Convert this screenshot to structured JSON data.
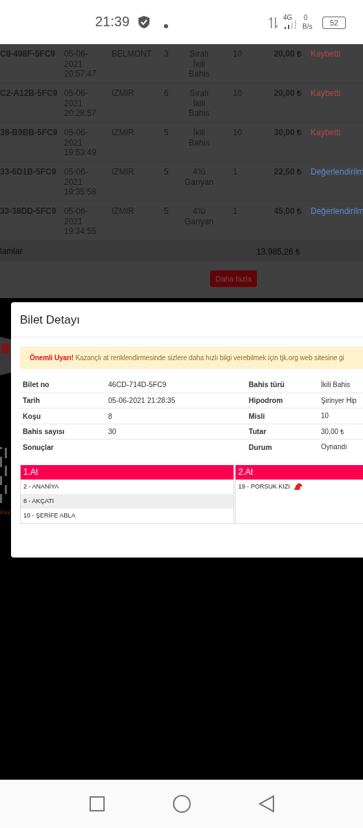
{
  "status_bar": {
    "time": "21:39",
    "network": "4G",
    "speed_value": "0",
    "speed_unit": "B/s",
    "battery": "52"
  },
  "background_table": {
    "rows": [
      {
        "ticket": "C8-498F-5FC9",
        "date": "05-06-2021 20:57:47",
        "hippodrome": "BELMONT",
        "race": "3",
        "bet_type": "Sıralı İkili Bahis",
        "multiplier": "10",
        "amount": "20,00 ₺",
        "status": "Kaybetti",
        "kind": "lost"
      },
      {
        "ticket": "C2-A12B-5FC9",
        "date": "05-06-2021 20:28:57",
        "hippodrome": "IZMIR",
        "race": "6",
        "bet_type": "Sıralı İkili Bahis",
        "multiplier": "10",
        "amount": "20,00 ₺",
        "status": "Kaybetti",
        "kind": "lost"
      },
      {
        "ticket": "38-B9BB-5FC9",
        "date": "05-06-2021 19:53:49",
        "hippodrome": "IZMIR",
        "race": "5",
        "bet_type": "İkili Bahis",
        "multiplier": "10",
        "amount": "30,00 ₺",
        "status": "Kaybetti",
        "kind": "lost"
      },
      {
        "ticket": "33-6D1B-5FC9",
        "date": "05-06-2021 19:35:58",
        "hippodrome": "IZMIR",
        "race": "5",
        "bet_type": "4'lü Ganyan",
        "multiplier": "1",
        "amount": "22,50 ₺",
        "status": "Değerlendirilm",
        "kind": "pending"
      },
      {
        "ticket": "33-38DD-5FC9",
        "date": "05-06-2021 19:34:55",
        "hippodrome": "IZMIR",
        "race": "5",
        "bet_type": "4'lü Ganyan",
        "multiplier": "1",
        "amount": "45,00 ₺",
        "status": "Değerlendirilm",
        "kind": "pending"
      }
    ],
    "total_label": "lamlar",
    "total_amount": "13.985,26 ₺",
    "more_button": "Daha fazla"
  },
  "background_fragment": {
    "text": "Kay"
  },
  "modal": {
    "title": "Bilet Detayı",
    "alert": {
      "strong": "Önemli Uyarı!",
      "text": "Kazançlı at renklendirmesinde sizlere daha hızlı bilgi verebilmek için tjk.org web sitesine gi"
    },
    "details": [
      {
        "label": "Bilet no",
        "value": "46CD-714D-5FC9",
        "label2": "Bahis türü",
        "value2": "İkili Bahis"
      },
      {
        "label": "Tarih",
        "value": "05-06-2021 21:28:35",
        "label2": "Hipodrom",
        "value2": "Şirinyer Hip"
      },
      {
        "label": "Koşu",
        "value": "8",
        "label2": "Misli",
        "value2": "10"
      },
      {
        "label": "Bahis sayısı",
        "value": "30",
        "label2": "Tutar",
        "value2": "30,00 ₺"
      },
      {
        "label": "Sonuçlar",
        "label2": "Durum",
        "value2": "Oynandı"
      }
    ],
    "results": [
      {
        "title": "1.At",
        "horses": [
          {
            "name": "2 - ANANİYA",
            "winner": false
          },
          {
            "name": "8 - AKÇATI",
            "winner": false
          },
          {
            "name": "10 - ŞERİFE ABLA",
            "winner": false
          }
        ]
      },
      {
        "title": "2.At",
        "horses": [
          {
            "name": "19 - PORSUK KIZI",
            "winner": true
          }
        ]
      }
    ]
  }
}
